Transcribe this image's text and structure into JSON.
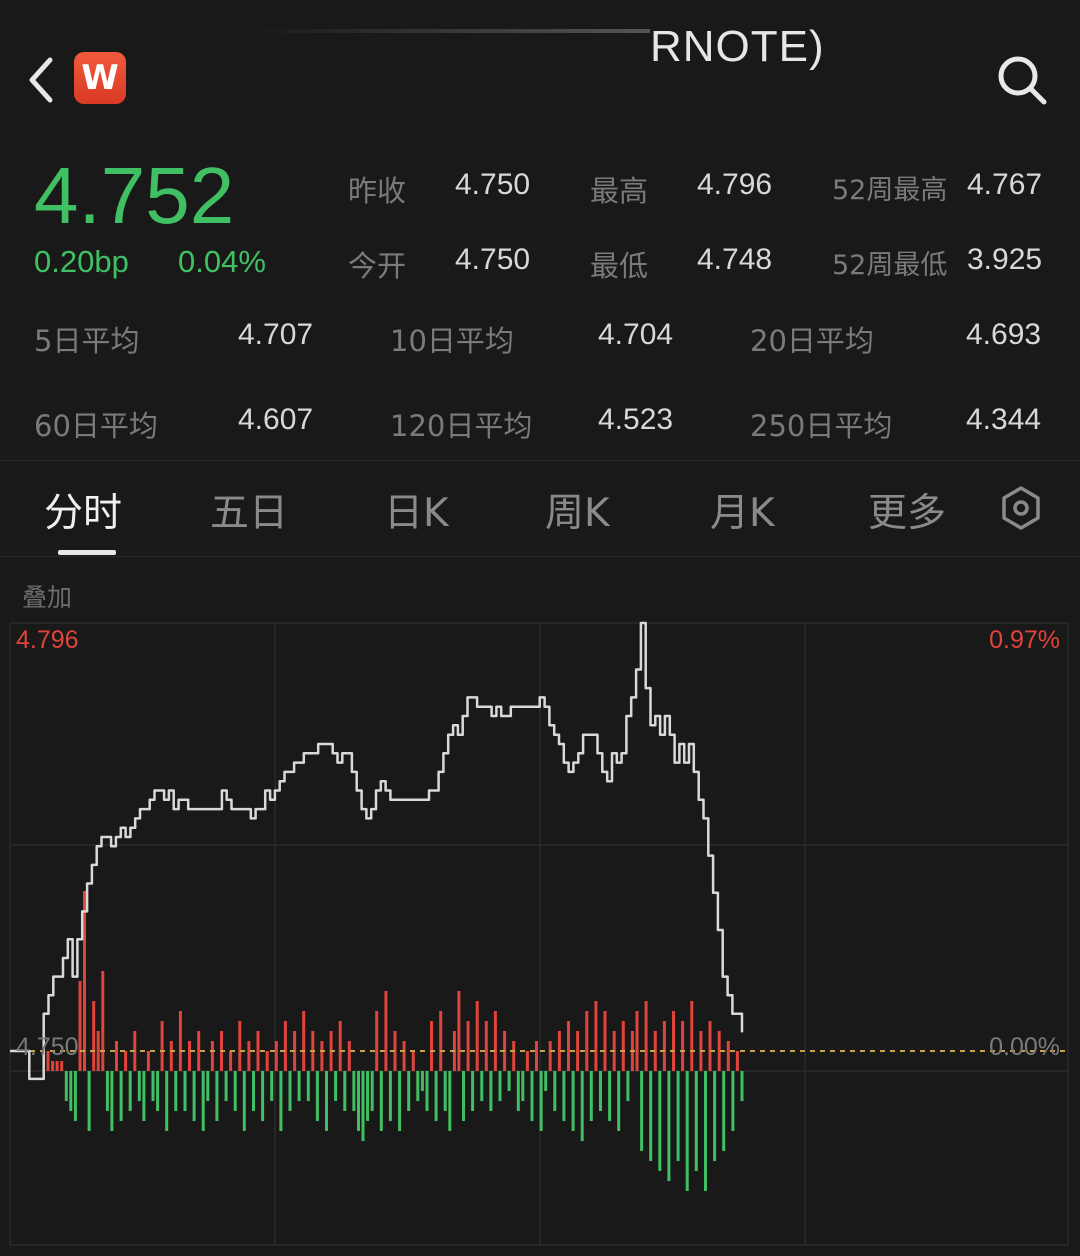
{
  "header": {
    "title": "RNOTE)",
    "logo_text": "W",
    "back_icon": "chevron-left-icon",
    "search_icon": "search-icon"
  },
  "quote": {
    "price": "4.752",
    "change_bp": "0.20bp",
    "change_pct": "0.04%",
    "stats": [
      {
        "label": "昨收",
        "value": "4.750"
      },
      {
        "label": "最高",
        "value": "4.796"
      },
      {
        "label": "52周最高",
        "value": "4.767"
      },
      {
        "label": "今开",
        "value": "4.750"
      },
      {
        "label": "最低",
        "value": "4.748"
      },
      {
        "label": "52周最低",
        "value": "3.925"
      }
    ],
    "averages": [
      {
        "label": "5日平均",
        "value": "4.707"
      },
      {
        "label": "10日平均",
        "value": "4.704"
      },
      {
        "label": "20日平均",
        "value": "4.693"
      },
      {
        "label": "60日平均",
        "value": "4.607"
      },
      {
        "label": "120日平均",
        "value": "4.523"
      },
      {
        "label": "250日平均",
        "value": "4.344"
      }
    ]
  },
  "tabs": [
    {
      "label": "分时",
      "active": true
    },
    {
      "label": "五日",
      "active": false
    },
    {
      "label": "日K",
      "active": false
    },
    {
      "label": "周K",
      "active": false
    },
    {
      "label": "月K",
      "active": false
    },
    {
      "label": "更多",
      "active": false
    }
  ],
  "overlay_label": "叠加",
  "colors": {
    "up": "#e0443a",
    "down": "#41c063",
    "line": "#d9d9d9",
    "ref": "#c8a24a"
  },
  "chart_data": {
    "type": "line",
    "y_max_label": "4.796",
    "y_ref_label": "4.750",
    "pct_max_label": "0.97%",
    "pct_ref_label": "0.00%",
    "y_range": [
      4.75,
      4.796
    ],
    "series": [
      {
        "values": [
          4.75,
          4.75,
          4.75,
          4.75,
          4.747,
          4.747,
          4.747,
          4.754,
          4.756,
          4.758,
          4.758,
          4.76,
          4.762,
          4.758,
          4.762,
          4.765,
          4.768,
          4.77,
          4.772,
          4.773,
          4.773,
          4.772,
          4.773,
          4.774,
          4.773,
          4.774,
          4.775,
          4.776,
          4.776,
          4.777,
          4.778,
          4.778,
          4.777,
          4.778,
          4.776,
          4.777,
          4.777,
          4.776,
          4.776,
          4.776,
          4.776,
          4.776,
          4.776,
          4.776,
          4.778,
          4.777,
          4.776,
          4.776,
          4.776,
          4.776,
          4.775,
          4.776,
          4.776,
          4.778,
          4.777,
          4.778,
          4.779,
          4.78,
          4.78,
          4.781,
          4.781,
          4.782,
          4.782,
          4.782,
          4.783,
          4.783,
          4.783,
          4.782,
          4.781,
          4.782,
          4.782,
          4.78,
          4.778,
          4.776,
          4.775,
          4.776,
          4.778,
          4.779,
          4.778,
          4.777,
          4.777,
          4.777,
          4.777,
          4.777,
          4.777,
          4.777,
          4.777,
          4.778,
          4.778,
          4.78,
          4.782,
          4.784,
          4.785,
          4.784,
          4.786,
          4.788,
          4.788,
          4.787,
          4.787,
          4.787,
          4.786,
          4.787,
          4.786,
          4.786,
          4.787,
          4.787,
          4.787,
          4.787,
          4.787,
          4.787,
          4.788,
          4.787,
          4.785,
          4.784,
          4.783,
          4.781,
          4.78,
          4.781,
          4.782,
          4.784,
          4.784,
          4.784,
          4.782,
          4.78,
          4.779,
          4.782,
          4.781,
          4.782,
          4.786,
          4.788,
          4.791,
          4.796,
          4.789,
          4.785,
          4.786,
          4.784,
          4.786,
          4.784,
          4.781,
          4.783,
          4.781,
          4.783,
          4.78,
          4.777,
          4.775,
          4.771,
          4.767,
          4.763,
          4.758,
          4.756,
          4.754,
          4.754,
          4.752
        ]
      }
    ],
    "volume": [
      2,
      1,
      1,
      1,
      -3,
      -4,
      -5,
      9,
      18,
      -6,
      7,
      4,
      10,
      -4,
      -6,
      3,
      -5,
      2,
      -4,
      4,
      -3,
      -5,
      2,
      -3,
      -4,
      5,
      -6,
      3,
      -4,
      6,
      -4,
      3,
      -5,
      4,
      -6,
      -3,
      3,
      -5,
      4,
      -3,
      2,
      -4,
      5,
      -6,
      3,
      -4,
      4,
      -5,
      2,
      -3,
      3,
      -6,
      5,
      -4,
      4,
      -3,
      6,
      -3,
      4,
      -5,
      3,
      -6,
      4,
      -3,
      5,
      -4,
      3,
      -4,
      -6,
      -7,
      -5,
      -4,
      6,
      -6,
      8,
      -5,
      4,
      -6,
      3,
      -4,
      2,
      -3,
      -2,
      -4,
      5,
      -5,
      6,
      -4,
      -6,
      4,
      8,
      -5,
      5,
      -4,
      7,
      -3,
      5,
      -4,
      6,
      -3,
      4,
      -2,
      3,
      -4,
      -3,
      2,
      -5,
      3,
      -6,
      -2,
      3,
      -4,
      4,
      -5,
      5,
      -6,
      4,
      -7,
      6,
      -5,
      7,
      -4,
      6,
      -5,
      4,
      -6,
      5,
      -3,
      4,
      6,
      -8,
      7,
      -9,
      4,
      -10,
      5,
      -11,
      6,
      -9,
      5,
      -12,
      7,
      -10,
      4,
      -12,
      5,
      -9,
      4,
      -8,
      3,
      -6,
      2,
      -3
    ]
  }
}
